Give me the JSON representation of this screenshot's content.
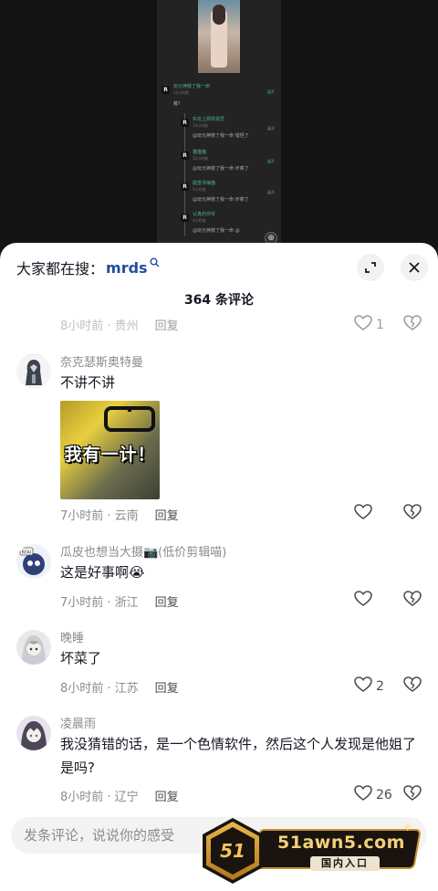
{
  "header": {
    "search_label": "大家都在搜：",
    "search_term": "mrds",
    "comment_count": "364 条评论"
  },
  "comments": [
    {
      "name": "",
      "text": "",
      "time": "8小时前 · 贵州",
      "reply": "回复",
      "likes": "1"
    },
    {
      "name": "奈克瑟斯奥特曼",
      "text": "不讲不讲",
      "image_caption": "我有一计！",
      "time": "7小时前 · 云南",
      "reply": "回复",
      "likes": ""
    },
    {
      "name": "瓜皮也想当大摄📷(低价剪辑喵)",
      "text": "这是好事啊😭",
      "time": "7小时前 · 浙江",
      "reply": "回复",
      "likes": ""
    },
    {
      "name": "晚睡",
      "text": "坏菜了",
      "time": "8小时前 · 江苏",
      "reply": "回复",
      "likes": "2"
    },
    {
      "name": "凌晨雨",
      "text": "我没猜错的话，是一个色情软件，然后这个人发现是他姐了是吗?",
      "time": "8小时前 · 辽宁",
      "reply": "回复",
      "likes": "26"
    }
  ],
  "input": {
    "placeholder": "发条评论，说说你的感受"
  },
  "watermark": {
    "badge": "51",
    "site": "51awn5.com",
    "entry": "国内入口"
  },
  "mini_thread": {
    "root_name": "玩元神救了我一命",
    "root_time": "13小时前",
    "root_text": "戴?",
    "replies": [
      {
        "name": "实名上网举报员",
        "time": "14小时前",
        "text": "@玩元神救了我一命 错怪了"
      },
      {
        "name": "猫猫猫",
        "time": "15小时前",
        "text": "@玩元神救了我一命 坏菜了"
      },
      {
        "name": "踏雪寻梅猫",
        "time": "5小时前",
        "text": "@玩元神救了我一命 坏菜了"
      },
      {
        "name": "认真的你爷",
        "time": "4小时前",
        "text": "@玩元神救了我一命 @"
      }
    ],
    "link": "展开"
  }
}
